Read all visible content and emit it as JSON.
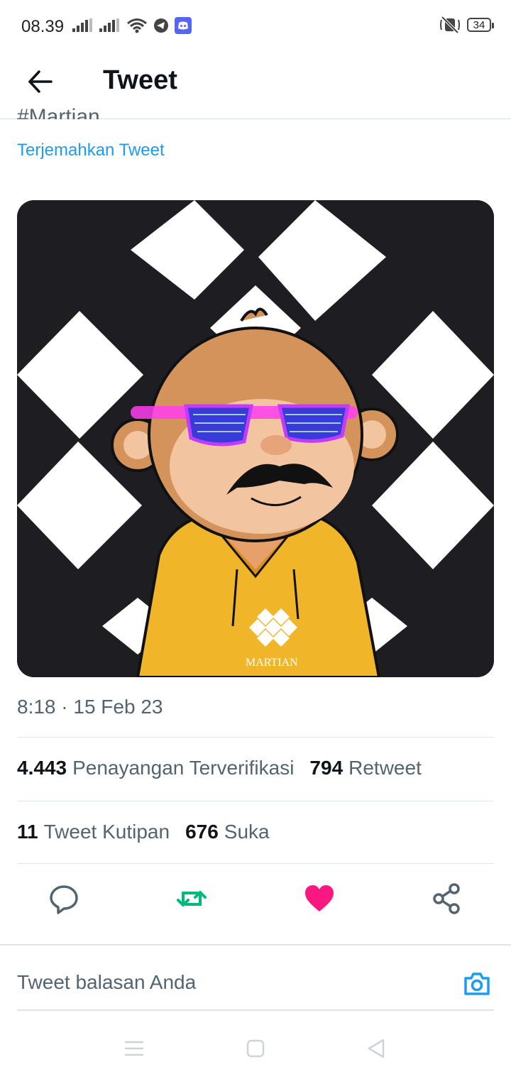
{
  "status_bar": {
    "time": "08.39",
    "battery": "34"
  },
  "header": {
    "title": "Tweet"
  },
  "tweet": {
    "cut_text": "#Martian",
    "translate_link": "Terjemahkan Tweet",
    "image_text": "MARTIAN",
    "timestamp": "8:18 · 15 Feb 23",
    "stats_row1": [
      {
        "count": "4.443",
        "label": "Penayangan Terverifikasi"
      },
      {
        "count": "794",
        "label": "Retweet"
      }
    ],
    "stats_row2": [
      {
        "count": "11",
        "label": "Tweet Kutipan"
      },
      {
        "count": "676",
        "label": "Suka"
      }
    ]
  },
  "reply": {
    "placeholder": "Tweet balasan Anda"
  },
  "colors": {
    "accent": "#1d9bf0",
    "retweet": "#00ba7c",
    "like": "#f91880",
    "text": "#0f1419",
    "muted": "#536471"
  },
  "icons": [
    "signal-icon",
    "wifi-icon",
    "telegram-icon",
    "discord-icon",
    "mute-icon",
    "battery-icon",
    "back-arrow-icon",
    "reply-icon",
    "retweet-icon",
    "like-icon",
    "share-icon",
    "camera-icon",
    "menu-nav-icon",
    "home-nav-icon",
    "back-nav-icon"
  ]
}
